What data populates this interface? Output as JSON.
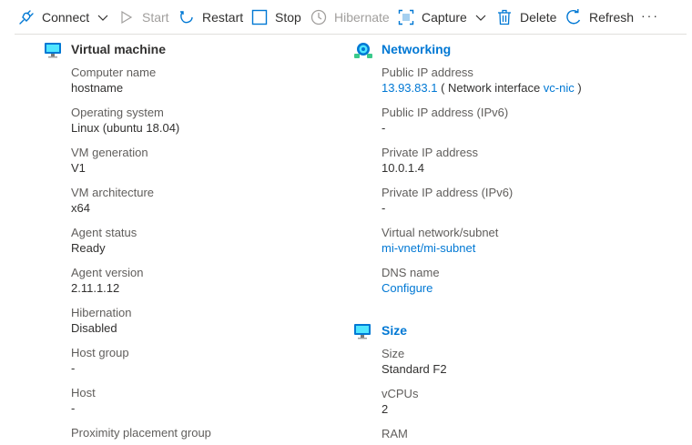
{
  "toolbar": {
    "connect": "Connect",
    "start": "Start",
    "restart": "Restart",
    "stop": "Stop",
    "hibernate": "Hibernate",
    "capture": "Capture",
    "delete": "Delete",
    "refresh": "Refresh",
    "more": "···"
  },
  "vm": {
    "title": "Virtual machine",
    "props": [
      {
        "label": "Computer name",
        "value": "hostname"
      },
      {
        "label": "Operating system",
        "value": "Linux (ubuntu 18.04)"
      },
      {
        "label": "VM generation",
        "value": "V1"
      },
      {
        "label": "VM architecture",
        "value": "x64"
      },
      {
        "label": "Agent status",
        "value": "Ready"
      },
      {
        "label": "Agent version",
        "value": "2.11.1.12"
      },
      {
        "label": "Hibernation",
        "value": "Disabled"
      },
      {
        "label": "Host group",
        "value": "-"
      },
      {
        "label": "Host",
        "value": "-"
      },
      {
        "label": "Proximity placement group",
        "value": ""
      }
    ]
  },
  "networking": {
    "title": "Networking",
    "public_ip_label": "Public IP address",
    "public_ip": "13.93.83.1",
    "nic_prefix": "( Network interface",
    "nic_link": "vc-nic",
    "nic_suffix": ")",
    "public_ipv6_label": "Public IP address (IPv6)",
    "public_ipv6": "-",
    "private_ip_label": "Private IP address",
    "private_ip": "10.0.1.4",
    "private_ipv6_label": "Private IP address (IPv6)",
    "private_ipv6": "-",
    "vnet_label": "Virtual network/subnet",
    "vnet": "mi-vnet/mi-subnet",
    "dns_label": "DNS name",
    "dns": "Configure"
  },
  "size": {
    "title": "Size",
    "size_label": "Size",
    "size_value": "Standard F2",
    "vcpus_label": "vCPUs",
    "vcpus_value": "2",
    "ram_label": "RAM"
  },
  "colors": {
    "accent": "#0078d4",
    "text": "#323130",
    "label": "#605e5c",
    "disabled": "#a19f9d"
  }
}
